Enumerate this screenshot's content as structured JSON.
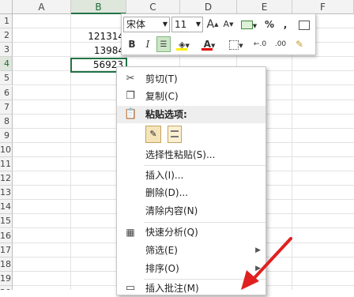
{
  "columns": [
    {
      "label": "A",
      "selected": false
    },
    {
      "label": "B",
      "selected": true
    },
    {
      "label": "C",
      "selected": false
    },
    {
      "label": "D",
      "selected": false
    },
    {
      "label": "E",
      "selected": false
    },
    {
      "label": "F",
      "selected": false
    }
  ],
  "rows": [
    "1",
    "2",
    "3",
    "4",
    "5",
    "6",
    "7",
    "8",
    "9",
    "10",
    "11",
    "12",
    "13",
    "14",
    "15",
    "16",
    "17",
    "18",
    "19",
    "20"
  ],
  "cells": {
    "b2": "121314",
    "b3": "13984",
    "b4": "56923"
  },
  "mini_toolbar": {
    "font_name": "宋体",
    "font_size": "11",
    "bold": "B",
    "italic": "I",
    "font_color_letter": "A",
    "increase_font": "A",
    "decrease_font": "A",
    "percent": "%",
    "comma": ",",
    "dec_inc": "←.0",
    "dec_dec": ".00",
    "accent_color": "#217346",
    "fill_color": "#ffee00",
    "font_color": "#e00000"
  },
  "context_menu": {
    "items": [
      {
        "label": "剪切(T)",
        "icon": "scissors-icon"
      },
      {
        "label": "复制(C)",
        "icon": "copy-icon"
      },
      {
        "label": "粘贴选项:",
        "icon": "paste-icon",
        "header": true
      },
      {
        "label": "选择性粘贴(S)...",
        "icon": ""
      },
      {
        "label": "插入(I)...",
        "icon": ""
      },
      {
        "label": "删除(D)...",
        "icon": ""
      },
      {
        "label": "清除内容(N)",
        "icon": ""
      },
      {
        "label": "快速分析(Q)",
        "icon": "quick-analysis-icon"
      },
      {
        "label": "筛选(E)",
        "icon": "",
        "submenu": true
      },
      {
        "label": "排序(O)",
        "icon": "",
        "submenu": true
      },
      {
        "label": "插入批注(M)",
        "icon": "comment-icon"
      }
    ]
  }
}
